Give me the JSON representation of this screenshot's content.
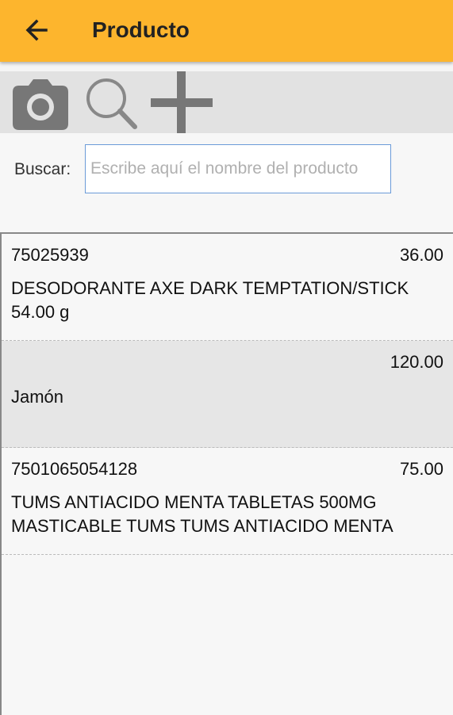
{
  "header": {
    "title": "Producto",
    "back_icon": "arrow-left-icon"
  },
  "toolbar": {
    "icons": [
      "camera-icon",
      "search-icon",
      "add-icon"
    ]
  },
  "search": {
    "label": "Buscar:",
    "placeholder": "Escribe aquí el nombre del producto",
    "value": ""
  },
  "products": [
    {
      "code": "75025939",
      "price": "36.00",
      "name": "DESODORANTE AXE DARK TEMPTATION/STICK 54.00 g"
    },
    {
      "code": "",
      "price": "120.00",
      "name": "Jamón"
    },
    {
      "code": "7501065054128",
      "price": "75.00",
      "name": "TUMS ANTIACIDO MENTA TABLETAS 500MG MASTICABLE TUMS TUMS ANTIACIDO MENTA"
    }
  ],
  "colors": {
    "appbar": "#fdb52d",
    "toolbar": "#e2e2e2",
    "alt_row": "#e6e6e6",
    "icon_gray": "#777777"
  }
}
